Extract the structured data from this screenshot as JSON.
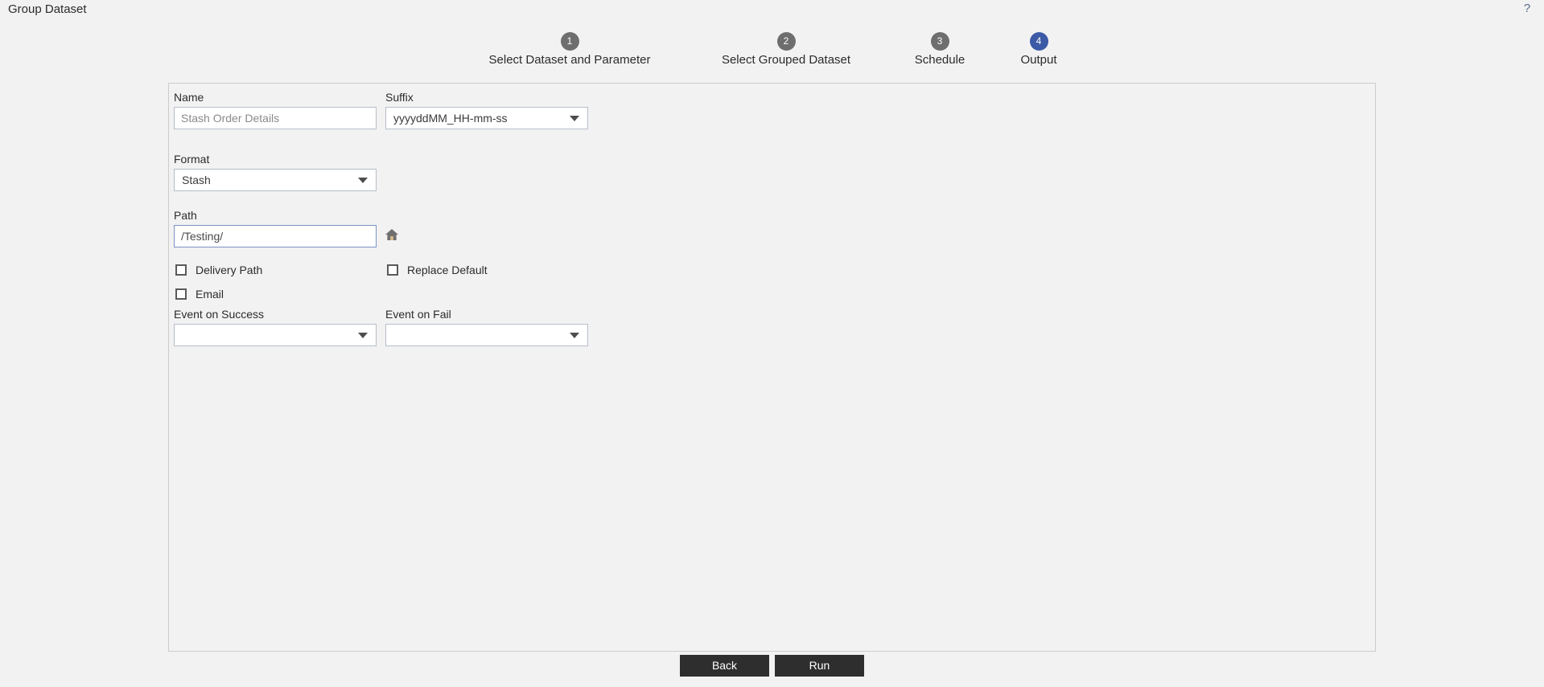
{
  "window": {
    "title": "Group Dataset",
    "help_icon": "question-mark-icon",
    "help_label": "?"
  },
  "stepper": {
    "steps": [
      {
        "number": "1",
        "label": "Select Dataset and Parameter",
        "active": false
      },
      {
        "number": "2",
        "label": "Select Grouped Dataset",
        "active": false
      },
      {
        "number": "3",
        "label": "Schedule",
        "active": false
      },
      {
        "number": "4",
        "label": "Output",
        "active": true
      }
    ],
    "active_color": "#3c5aa6",
    "inactive_color": "#6e6e6e"
  },
  "form": {
    "name": {
      "label": "Name",
      "value": "",
      "placeholder": "Stash Order Details"
    },
    "suffix": {
      "label": "Suffix",
      "value": "yyyyddMM_HH-mm-ss"
    },
    "format": {
      "label": "Format",
      "value": "Stash"
    },
    "path": {
      "label": "Path",
      "value": "/Testing/",
      "home_icon": "home-icon"
    },
    "checkboxes": [
      {
        "label": "Delivery Path",
        "checked": false
      },
      {
        "label": "Replace Default",
        "checked": false
      },
      {
        "label": "Email",
        "checked": false
      }
    ],
    "event_on_success": {
      "label": "Event on Success",
      "value": ""
    },
    "event_on_fail": {
      "label": "Event on Fail",
      "value": ""
    }
  },
  "footer": {
    "back_label": "Back",
    "run_label": "Run"
  }
}
